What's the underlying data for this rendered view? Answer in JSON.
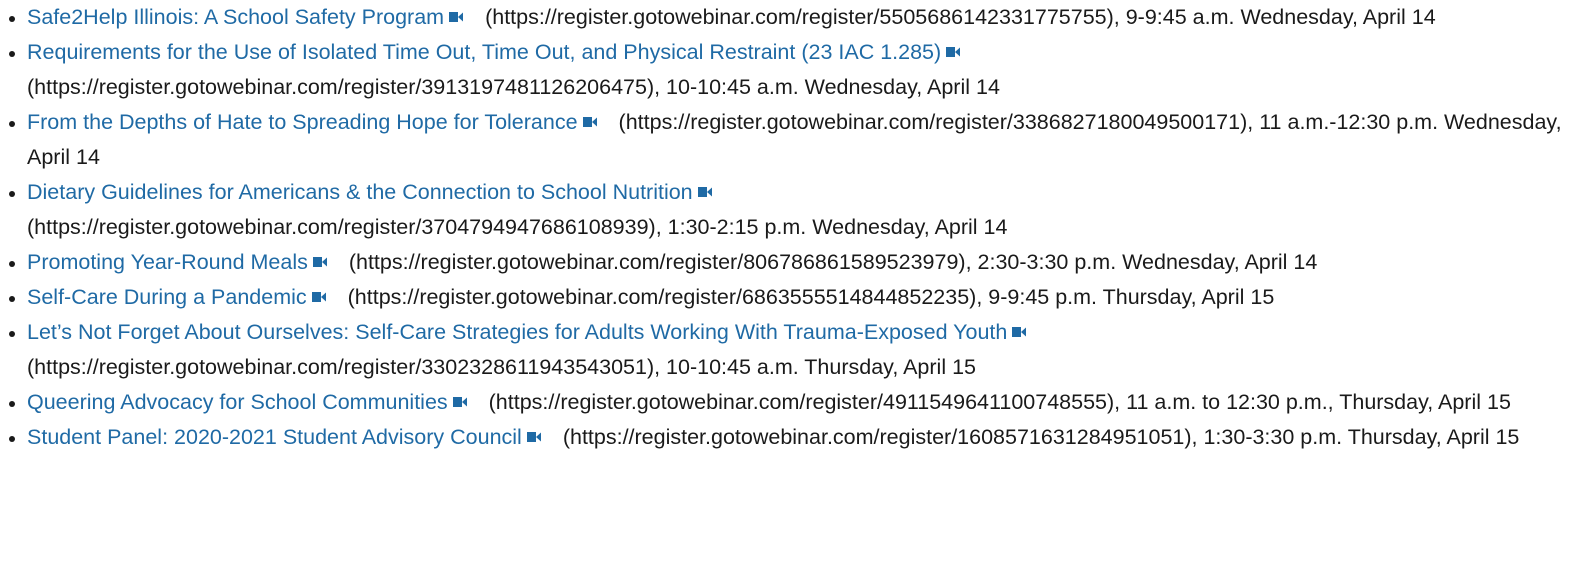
{
  "items": [
    {
      "title": "Safe2Help Illinois: A School Safety Program",
      "icon": "video-camera-icon",
      "rest": "(https://register.gotowebinar.com/register/5505686142331775755), 9-9:45 a.m. Wednesday, April 14",
      "break_after_icon": false
    },
    {
      "title": "Requirements for the Use of Isolated Time Out, Time Out, and Physical Restraint (23 IAC 1.285)",
      "icon": "video-camera-icon",
      "rest": "(https://register.gotowebinar.com/register/3913197481126206475), 10-10:45 a.m. Wednesday, April 14",
      "break_after_icon": true
    },
    {
      "title": "From the Depths of Hate to Spreading Hope for Tolerance",
      "icon": "video-camera-icon",
      "rest": "(https://register.gotowebinar.com/register/3386827180049500171), 11 a.m.-12:30 p.m. Wednesday, April 14",
      "break_after_icon": false
    },
    {
      "title": "Dietary Guidelines for Americans & the Connection to School Nutrition",
      "icon": "video-camera-icon",
      "rest": "(https://register.gotowebinar.com/register/3704794947686108939), 1:30-2:15 p.m. Wednesday, April 14",
      "break_after_icon": true
    },
    {
      "title": "Promoting Year-Round Meals",
      "icon": "video-camera-icon",
      "rest": "(https://register.gotowebinar.com/register/806786861589523979), 2:30-3:30 p.m. Wednesday, April 14",
      "break_after_icon": false
    },
    {
      "title": "Self-Care During a Pandemic",
      "icon": "video-camera-icon",
      "rest": "(https://register.gotowebinar.com/register/6863555514844852235), 9-9:45 p.m. Thursday, April 15",
      "break_after_icon": false
    },
    {
      "title": "Let’s Not Forget About Ourselves: Self-Care Strategies for Adults Working With Trauma-Exposed Youth",
      "icon": "video-camera-icon",
      "rest": "(https://register.gotowebinar.com/register/3302328611943543051), 10-10:45 a.m. Thursday, April 15",
      "break_after_icon": true
    },
    {
      "title": "Queering Advocacy for School Communities",
      "icon": "video-camera-icon",
      "rest": "(https://register.gotowebinar.com/register/4911549641100748555), 11 a.m. to 12:30 p.m., Thursday, April 15",
      "break_after_icon": false
    },
    {
      "title": "Student Panel: 2020-2021 Student Advisory Council",
      "icon": "video-camera-icon",
      "rest": "(https://register.gotowebinar.com/register/1608571631284951051), 1:30-3:30 p.m. Thursday, April 15",
      "break_after_icon": false
    }
  ],
  "colors": {
    "link": "#1f6aa5",
    "text": "#1a1a1a"
  }
}
